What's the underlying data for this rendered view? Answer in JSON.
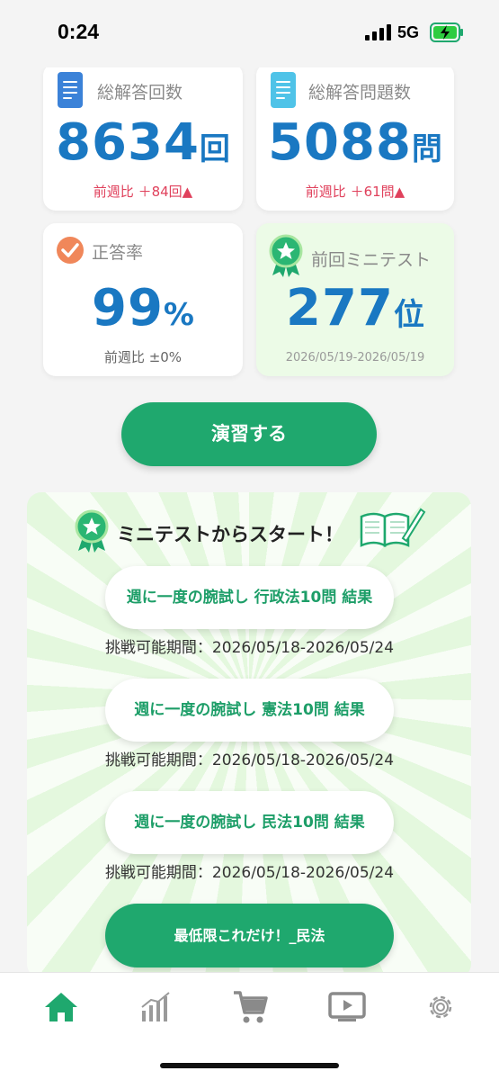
{
  "status": {
    "time": "0:24",
    "network": "5G"
  },
  "stats": {
    "total_answers": {
      "label": "総解答回数",
      "value": "8634",
      "unit": "回",
      "change": "前週比 ＋84回"
    },
    "total_questions": {
      "label": "総解答問題数",
      "value": "5088",
      "unit": "問",
      "change": "前週比 ＋61問"
    },
    "accuracy": {
      "label": "正答率",
      "value": "99",
      "unit": "%",
      "change": "前週比 ±0%"
    },
    "last_minitest": {
      "label": "前回ミニテスト",
      "value": "277",
      "unit": "位",
      "period": "2026/05/19-2026/05/19"
    }
  },
  "practice_button": "演習する",
  "minitest": {
    "title": "ミニテストからスタート！",
    "tests": [
      {
        "label": "週に一度の腕試し 行政法10問 結果",
        "period": "挑戦可能期間：2026/05/18-2026/05/24"
      },
      {
        "label": "週に一度の腕試し 憲法10問 結果",
        "period": "挑戦可能期間：2026/05/18-2026/05/24"
      },
      {
        "label": "週に一度の腕試し 民法10問 結果",
        "period": "挑戦可能期間：2026/05/18-2026/05/24"
      }
    ],
    "extra_button": "最低限これだけ！_民法"
  },
  "tabs": [
    "home-icon",
    "chart-icon",
    "cart-icon",
    "video-icon",
    "settings-icon"
  ],
  "colors": {
    "accent": "#1fa86e",
    "value_blue": "#1a78c2",
    "change_red": "#e0415c"
  }
}
